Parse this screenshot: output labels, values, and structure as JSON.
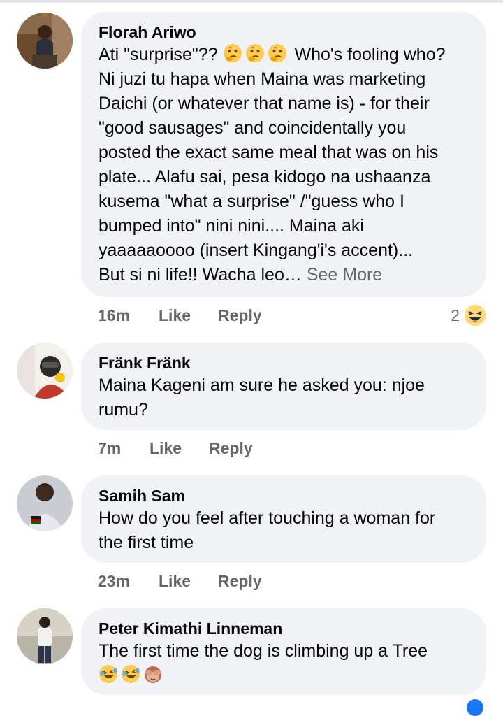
{
  "comments": [
    {
      "author": "Florah Ariwo",
      "text_lines": [
        "Who's fooling who?",
        "Ni juzi tu hapa when Maina was marketing",
        "Daichi (or whatever that name is) - for their",
        "\"good sausages\" and coincidentally you",
        "posted the exact same meal that was on his",
        "plate... Alafu sai, pesa kidogo na ushaanza",
        "kusema \"what a surprise\" /\"guess who I",
        "bumped into\" nini nini.... Maina aki",
        "yaaaaaoooo (insert Kingang'i's accent)...",
        "But si ni life!! Wacha leo…"
      ],
      "text_prefix": "Ati \"surprise\"??",
      "prefix_emojis": [
        "thinking-face",
        "thinking-face",
        "thinking-face"
      ],
      "see_more": "See More",
      "time": "16m",
      "like": "Like",
      "reply": "Reply",
      "reaction_count": "2",
      "reaction_emoji": "haha-face"
    },
    {
      "author": "Fränk Fränk",
      "text_lines": [
        "Maina Kageni am sure he asked you: njoe",
        "rumu?"
      ],
      "time": "7m",
      "like": "Like",
      "reply": "Reply"
    },
    {
      "author": "Samih Sam",
      "text_lines": [
        "How do you feel after touching a woman for",
        "the first time"
      ],
      "time": "23m",
      "like": "Like",
      "reply": "Reply"
    },
    {
      "author": "Peter Kimathi Linneman",
      "text_lines": [
        "The first time the dog is climbing up a Tree"
      ],
      "trailing_emojis": [
        "rolling-laughing-face",
        "rolling-laughing-face",
        "see-no-evil-monkey"
      ]
    }
  ],
  "colors": {
    "bubble": "#f0f2f5",
    "secondary_text": "#65676b",
    "primary_text": "#050505",
    "accent": "#1877f2"
  }
}
